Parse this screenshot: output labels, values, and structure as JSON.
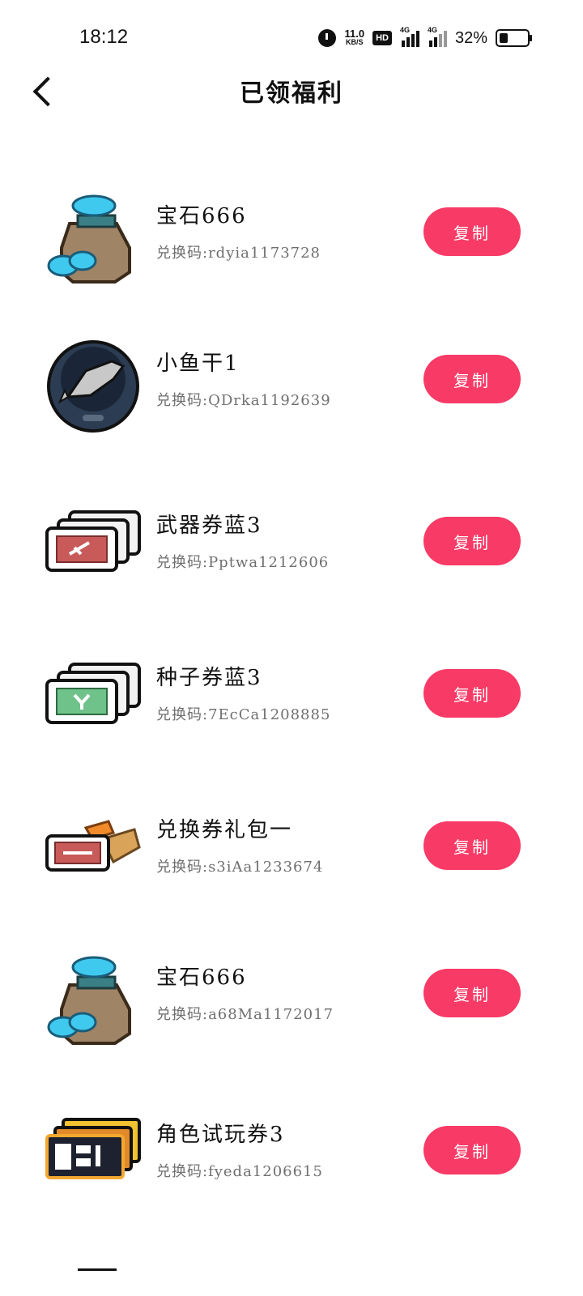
{
  "status_bar": {
    "time": "18:12",
    "net_speed_value": "11.0",
    "net_speed_unit": "KB/S",
    "hd_badge": "HD",
    "signal_1_label": "4G",
    "signal_2_label": "4G",
    "battery_percent": "32%",
    "battery_level": 0.32
  },
  "header": {
    "title": "已领福利",
    "back_icon": "chevron-left-icon"
  },
  "items": [
    {
      "name": "宝石666",
      "code": "兑换码:rdyia1173728",
      "copy_label": "复制",
      "icon": "gem-bag-icon"
    },
    {
      "name": "小鱼干1",
      "code": "兑换码:QDrka1192639",
      "copy_label": "复制",
      "icon": "fish-bowl-icon"
    },
    {
      "name": "武器券蓝3",
      "code": "兑换码:Pptwa1212606",
      "copy_label": "复制",
      "icon": "weapon-ticket-icon"
    },
    {
      "name": "种子券蓝3",
      "code": "兑换码:7EcCa1208885",
      "copy_label": "复制",
      "icon": "seed-ticket-icon"
    },
    {
      "name": "兑换券礼包一",
      "code": "兑换码:s3iAa1233674",
      "copy_label": "复制",
      "icon": "coupon-pack-icon"
    },
    {
      "name": "宝石666",
      "code": "兑换码:a68Ma1172017",
      "copy_label": "复制",
      "icon": "gem-bag-icon"
    },
    {
      "name": "角色试玩券3",
      "code": "兑换码:fyeda1206615",
      "copy_label": "复制",
      "icon": "character-ticket-icon"
    }
  ],
  "colors": {
    "accent": "#f83a66",
    "code_text": "#6f6f6f"
  }
}
